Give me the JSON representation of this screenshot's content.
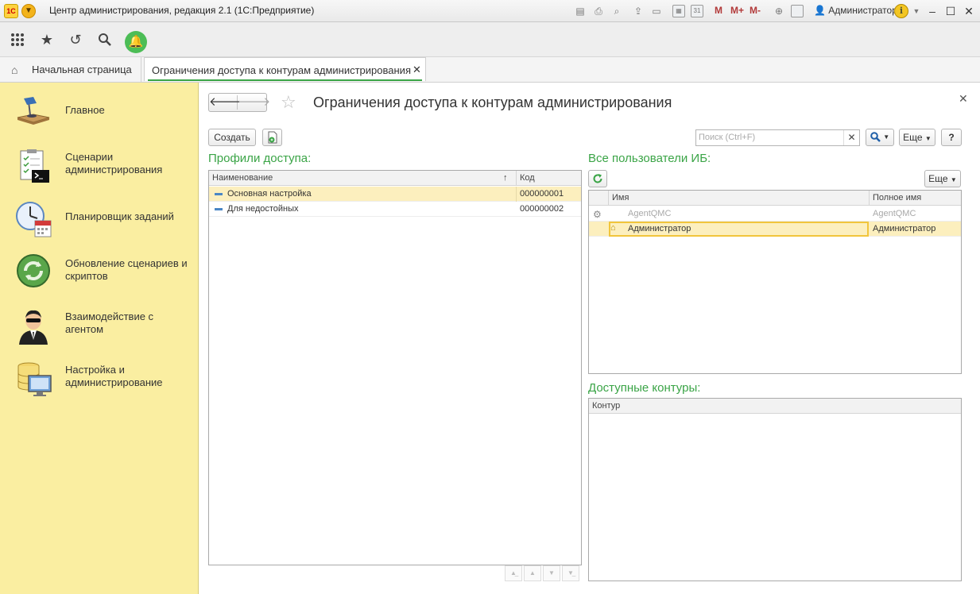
{
  "window": {
    "title": "Центр администрирования, редакция 2.1  (1С:Предприятие)",
    "logo_text": "1С",
    "user": "Администратор",
    "m_labels": [
      "M",
      "M+",
      "M-"
    ]
  },
  "tabs": {
    "home_label": "Начальная страница",
    "active_label": "Ограничения доступа к контурам администрирования"
  },
  "sidebar": {
    "items": [
      {
        "label": "Главное",
        "icon": "desk-lamp-icon"
      },
      {
        "label": "Сценарии администрирования",
        "icon": "checklist-terminal-icon"
      },
      {
        "label": "Планировщик заданий",
        "icon": "clock-calendar-icon"
      },
      {
        "label": "Обновление сценариев и скриптов",
        "icon": "refresh-globe-icon"
      },
      {
        "label": "Взаимодействие с агентом",
        "icon": "agent-icon"
      },
      {
        "label": "Настройка и администрирование",
        "icon": "database-monitor-icon"
      }
    ]
  },
  "main": {
    "title": "Ограничения доступа к контурам администрирования",
    "create_label": "Создать",
    "search_placeholder": "Поиск (Ctrl+F)",
    "more_label": "Еще",
    "help_label": "?"
  },
  "profiles": {
    "title": "Профили доступа:",
    "columns": [
      "Наименование",
      "Код"
    ],
    "sort_indicator": "↑",
    "rows": [
      {
        "name": "Основная настройка",
        "code": "000000001"
      },
      {
        "name": "Для недостойных",
        "code": "000000002"
      }
    ]
  },
  "users": {
    "title": "Все пользователи ИБ:",
    "more_label": "Еще",
    "columns": [
      "Имя",
      "Полное имя"
    ],
    "rows": [
      {
        "name": "AgentQMC",
        "full_name": "AgentQMC"
      },
      {
        "name": "Администратор",
        "full_name": "Администратор"
      }
    ]
  },
  "contours": {
    "title": "Доступные контуры:",
    "columns": [
      "Контур"
    ]
  },
  "colors": {
    "accent_green": "#3aa446",
    "sidebar_bg": "#faeea1",
    "selection": "#fcefbe"
  }
}
